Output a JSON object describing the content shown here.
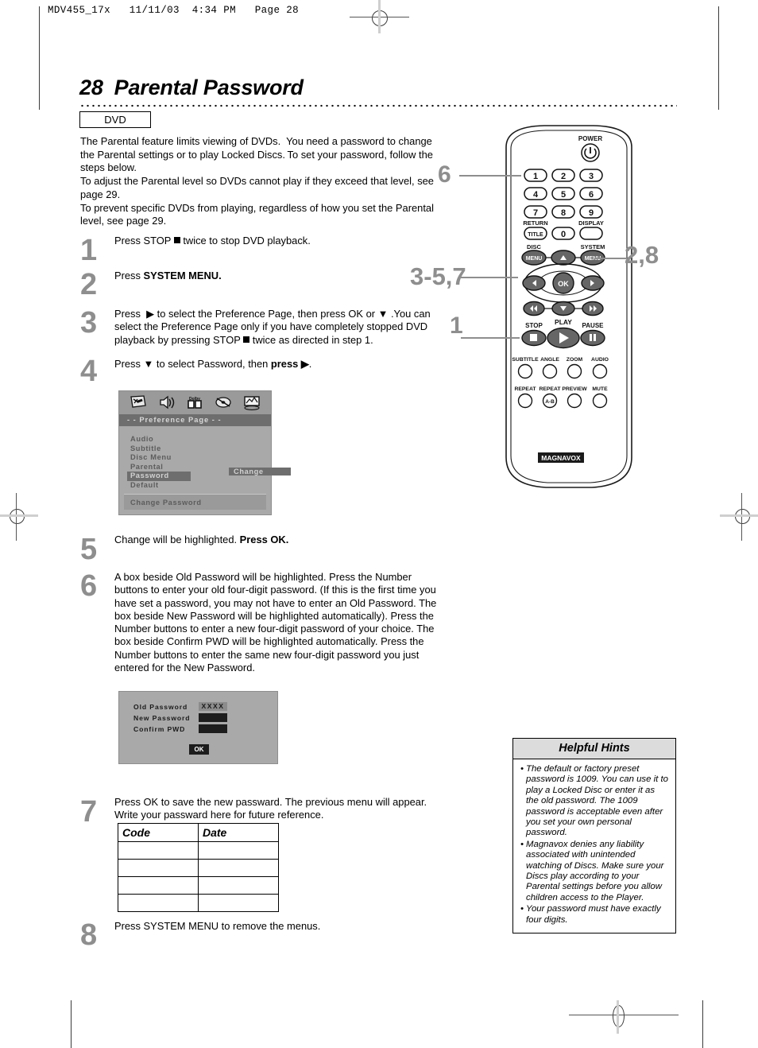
{
  "print_marks": {
    "filestamp": "MDV455_17x   11/11/03  4:34 PM   Page 28"
  },
  "header": {
    "page_number": "28",
    "title": "Parental Password",
    "media_badge": "DVD"
  },
  "intro": "The Parental feature limits viewing of DVDs. You need a password to change the Parental settings or to play Locked Discs. To set your password, follow the steps below.\nTo adjust the Parental level so DVDs cannot play if they exceed that level, see page 29.\nTo prevent specific DVDs from playing, regardless of how you set the Parental level, see page 29.",
  "steps": [
    {
      "num": "1",
      "text": "Press STOP ■ twice to stop DVD playback."
    },
    {
      "num": "2",
      "text": "Press SYSTEM MENU.",
      "bold_tail": "SYSTEM MENU."
    },
    {
      "num": "3",
      "text": "Press ▶ to select the Preference Page, then press OK or ▼ . You can select the Preference Page only if you have completely stopped DVD playback by pressing STOP ■ twice as directed in step 1."
    },
    {
      "num": "4",
      "text": "Press ▼ to select Password, then press ▶."
    },
    {
      "num": "5",
      "text": "Change will be highlighted. Press OK."
    },
    {
      "num": "6",
      "text": "A box beside Old Password will be highlighted. Press the Number buttons to enter your old four-digit password. (If this is the first time you have set a password, you may not have to enter an Old Password. The box beside New Password will be highlighted automatically). Press the Number buttons to enter a new four-digit password of your choice. The box beside Confirm PWD will be highlighted automatically. Press the Number buttons to enter the same new four-digit password you just entered for the New Password."
    },
    {
      "num": "7",
      "text": "Press OK to save the new passward.  The previous menu will appear. Write your passward here for future reference."
    },
    {
      "num": "8",
      "text": "Press SYSTEM MENU to remove the menus."
    }
  ],
  "osd_preference": {
    "icons": [
      "general-setup-icon",
      "audio-setup-icon",
      "dolby-setup-icon",
      "video-setup-icon",
      "preference-setup-icon"
    ],
    "title": "- -  Preference Page  - -",
    "items": [
      {
        "label": "Audio",
        "selected": false,
        "value": ""
      },
      {
        "label": "Subtitle",
        "selected": false,
        "value": ""
      },
      {
        "label": "Disc Menu",
        "selected": false,
        "value": ""
      },
      {
        "label": "Parental",
        "selected": false,
        "value": ""
      },
      {
        "label": "Password",
        "selected": true,
        "value": "Change"
      },
      {
        "label": "Default",
        "selected": false,
        "value": ""
      }
    ],
    "footer": "Change Password"
  },
  "osd_password": {
    "rows": [
      {
        "label": "Old Password",
        "value": "XXXX",
        "highlighted": true
      },
      {
        "label": "New Password",
        "value": "",
        "highlighted": false
      },
      {
        "label": "Confirm PWD",
        "value": "",
        "highlighted": false
      }
    ],
    "ok_label": "OK"
  },
  "code_table": {
    "headers": [
      "Code",
      "Date"
    ],
    "rows": [
      [
        "",
        ""
      ],
      [
        "",
        ""
      ],
      [
        "",
        ""
      ],
      [
        "",
        ""
      ]
    ]
  },
  "hints": {
    "title": "Helpful Hints",
    "bullet": "•",
    "items": [
      "The default or factory preset password is 1009. You can use it to play a Locked Disc or enter it as the old password. The 1009 password is acceptable even after you set your own personal password.",
      "Magnavox denies any liability associated with unintended watching of Discs. Make sure your Discs play according to your Parental settings before you allow children access to the Player.",
      "Your password must have exactly four digits."
    ]
  },
  "remote": {
    "brand": "MAGNAVOX",
    "power_label": "POWER",
    "number_keys": [
      "1",
      "2",
      "3",
      "4",
      "5",
      "6",
      "7",
      "8",
      "9",
      "0"
    ],
    "labels": {
      "return": "RETURN",
      "title": "TITLE",
      "display": "DISPLAY",
      "disc": "DISC",
      "disc_menu": "MENU",
      "system": "SYSTEM",
      "system_menu": "MENU",
      "ok": "OK",
      "stop": "STOP",
      "play": "PLAY",
      "pause": "PAUSE"
    },
    "function_row_1": [
      "SUBTITLE",
      "ANGLE",
      "ZOOM",
      "AUDIO"
    ],
    "function_row_2": [
      "REPEAT",
      "REPEAT",
      "PREVIEW",
      "MUTE"
    ],
    "repeat_ab": "A-B",
    "callouts": [
      {
        "id": "callout-6",
        "text": "6"
      },
      {
        "id": "callout-3-5-7",
        "text": "3-5,7"
      },
      {
        "id": "callout-1",
        "text": "1"
      },
      {
        "id": "callout-2-8",
        "text": "2,8"
      }
    ]
  },
  "colors": {
    "step_number": "#8e8e8e",
    "osd_background": "#a9a9a9",
    "osd_highlight": "#6e6e6e",
    "hints_header": "#dcdcdc"
  }
}
